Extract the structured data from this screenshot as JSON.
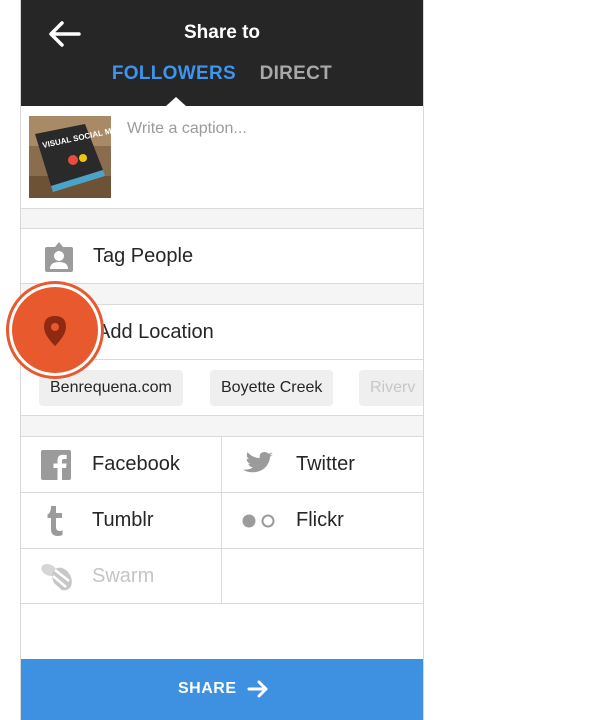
{
  "header": {
    "title": "Share to",
    "tabs": [
      {
        "label": "FOLLOWERS",
        "active": true
      },
      {
        "label": "DIRECT",
        "active": false
      }
    ]
  },
  "caption": {
    "placeholder": "Write a caption...",
    "thumbnail_text": "VISUAL SOCIAL MEDIA"
  },
  "options": {
    "tag_people": "Tag People",
    "add_location": "Add Location"
  },
  "location_suggestions": [
    "Benrequena.com",
    "Boyette Creek",
    "Riverv"
  ],
  "networks": [
    {
      "label": "Facebook",
      "icon": "facebook-icon",
      "enabled": true
    },
    {
      "label": "Twitter",
      "icon": "twitter-icon",
      "enabled": true
    },
    {
      "label": "Tumblr",
      "icon": "tumblr-icon",
      "enabled": true
    },
    {
      "label": "Flickr",
      "icon": "flickr-icon",
      "enabled": true
    },
    {
      "label": "Swarm",
      "icon": "swarm-icon",
      "enabled": false
    }
  ],
  "footer": {
    "share_label": "SHARE"
  },
  "colors": {
    "header_bg": "#262626",
    "active_tab": "#3c95f0",
    "inactive_tab": "#a8a8a8",
    "share_bg": "#3e90e0",
    "location_highlight": "#e8592d",
    "icon_gray": "#9b9b9b"
  }
}
